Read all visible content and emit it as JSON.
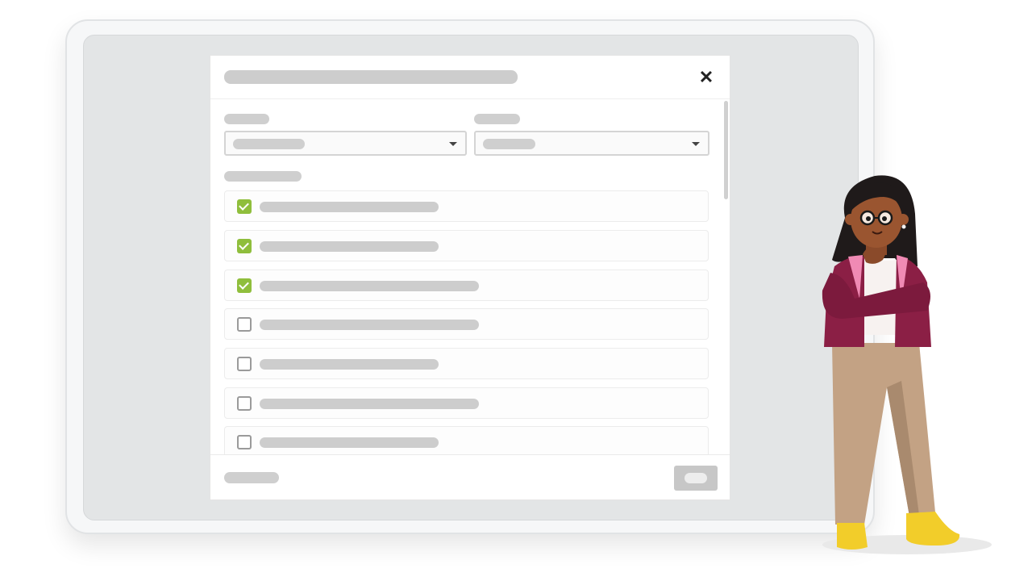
{
  "modal": {
    "title": "",
    "close_symbol": "✕",
    "filters": [
      {
        "label": "",
        "selected": ""
      },
      {
        "label": "",
        "selected": ""
      }
    ],
    "list_label": "",
    "items": [
      {
        "label": "",
        "checked": true
      },
      {
        "label": "",
        "checked": true
      },
      {
        "label": "",
        "checked": true
      },
      {
        "label": "",
        "checked": false
      },
      {
        "label": "",
        "checked": false
      },
      {
        "label": "",
        "checked": false
      },
      {
        "label": "",
        "checked": false
      }
    ],
    "footer_text": "",
    "footer_button_label": ""
  },
  "colors": {
    "checkbox_checked": "#8fbe3c",
    "placeholder_bar": "#cdcdcd",
    "screen_bg": "#e3e5e6",
    "jacket": "#8b1f45",
    "trousers": "#c3a284",
    "shoes": "#f2cd2a"
  },
  "icons": [
    "close-icon",
    "chevron-down-icon",
    "checkbox-checked-icon",
    "checkbox-unchecked-icon"
  ]
}
